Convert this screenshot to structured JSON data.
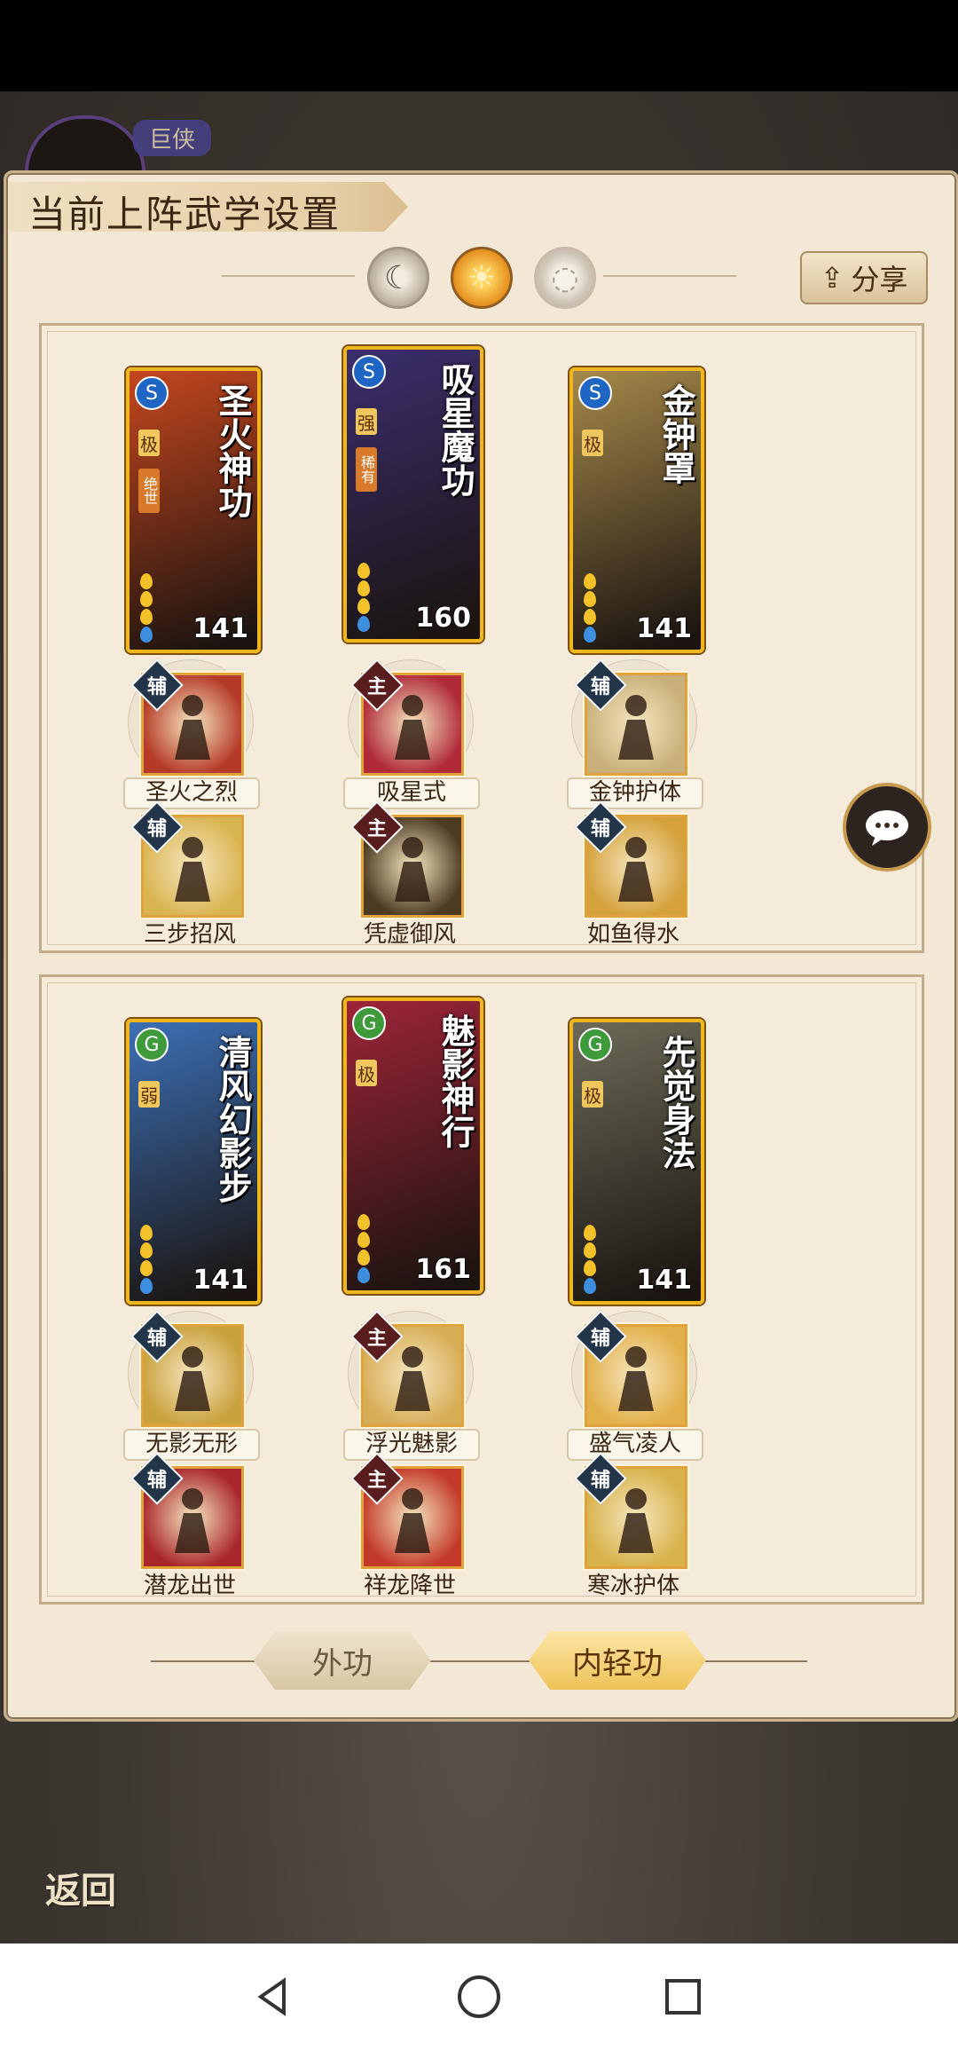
{
  "title": "当前上阵武学设置",
  "share_label": "分享",
  "rank_badge": "巨侠",
  "chat_icon": "chat-bubble-icon",
  "icons": {
    "fu": "辅",
    "zhu": "主"
  },
  "sections": [
    {
      "cards": [
        {
          "name": "圣火神功",
          "level": "141",
          "element": "S",
          "color": "#c4461e",
          "grade": "极",
          "tag": "绝世"
        },
        {
          "name": "吸星魔功",
          "level": "160",
          "element": "S",
          "color": "#3b2e6e",
          "grade": "强",
          "tag": "稀有"
        },
        {
          "name": "金钟罩",
          "level": "141",
          "element": "S",
          "color": "#a5884a",
          "grade": "极",
          "tag": ""
        }
      ],
      "skills_row1": [
        {
          "label": "圣火之烈",
          "type": "辅",
          "color": "#b53a28"
        },
        {
          "label": "吸星式",
          "type": "主",
          "color": "#b02a3a"
        },
        {
          "label": "金钟护体",
          "type": "辅",
          "color": "#c9b07a"
        }
      ],
      "skills_row2": [
        {
          "label": "三步招风",
          "type": "辅",
          "color": "#d9b552"
        },
        {
          "label": "凭虚御风",
          "type": "主",
          "color": "#4d3a23"
        },
        {
          "label": "如鱼得水",
          "type": "辅",
          "color": "#d4a13a"
        }
      ]
    },
    {
      "cards": [
        {
          "name": "清风幻影步",
          "level": "141",
          "element": "G",
          "color": "#3b6fb5",
          "grade": "弱",
          "tag": ""
        },
        {
          "name": "魅影神行",
          "level": "161",
          "element": "G",
          "color": "#9d2438",
          "grade": "极",
          "tag": ""
        },
        {
          "name": "先觉身法",
          "level": "141",
          "element": "G",
          "color": "#6c6a58",
          "grade": "极",
          "tag": ""
        }
      ],
      "skills_row1": [
        {
          "label": "无影无形",
          "type": "辅",
          "color": "#c9a23e"
        },
        {
          "label": "浮光魅影",
          "type": "主",
          "color": "#d7ae58"
        },
        {
          "label": "盛气凌人",
          "type": "辅",
          "color": "#e2b04a"
        }
      ],
      "skills_row2": [
        {
          "label": "潜龙出世",
          "type": "辅",
          "color": "#a9262a"
        },
        {
          "label": "祥龙降世",
          "type": "主",
          "color": "#c33a2a"
        },
        {
          "label": "寒冰护体",
          "type": "辅",
          "color": "#d7b24a"
        }
      ]
    }
  ],
  "tabs": {
    "outer": "外功",
    "inner": "内轻功"
  },
  "back_label": "返回",
  "nav": {
    "back": "nav-back-icon",
    "home": "nav-home-icon",
    "recent": "nav-recent-icon"
  }
}
